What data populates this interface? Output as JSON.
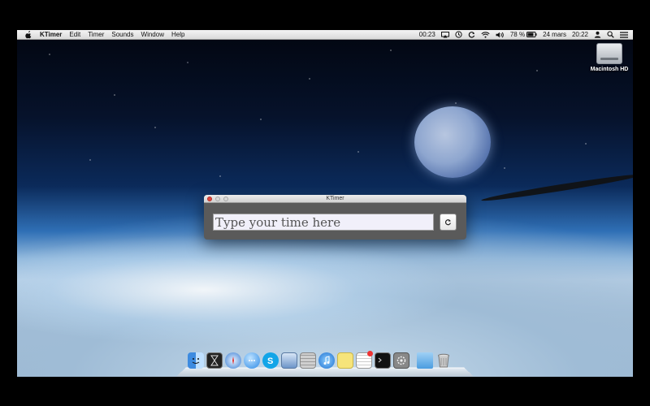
{
  "menubar": {
    "app_name": "KTimer",
    "menus": [
      "Edit",
      "Timer",
      "Sounds",
      "Window",
      "Help"
    ],
    "status": {
      "timer_readout": "00:23",
      "battery": "78 %",
      "date": "24 mars",
      "time": "20:22"
    },
    "icons": [
      "apple-icon",
      "airplay-icon",
      "time-machine-icon",
      "sync-icon",
      "wifi-icon",
      "volume-icon",
      "user-icon",
      "list-icon"
    ]
  },
  "desktop": {
    "hd_label": "Macintosh HD"
  },
  "window": {
    "title": "KTimer",
    "input_placeholder": "Type your time here",
    "input_value": "",
    "reset_icon": "refresh-icon"
  },
  "dock": {
    "items": [
      "finder-icon",
      "ktimer-icon",
      "safari-icon",
      "messages-icon",
      "skype-icon",
      "preview-icon",
      "calculator-icon",
      "itunes-icon",
      "stickies-icon",
      "textedit-icon",
      "terminal-icon",
      "system-prefs-icon",
      "folder-icon",
      "trash-icon"
    ]
  },
  "colors": {
    "close_button": "#e0473e",
    "window_body": "#5a5a5a",
    "input_bg": "#f1f0fa"
  }
}
